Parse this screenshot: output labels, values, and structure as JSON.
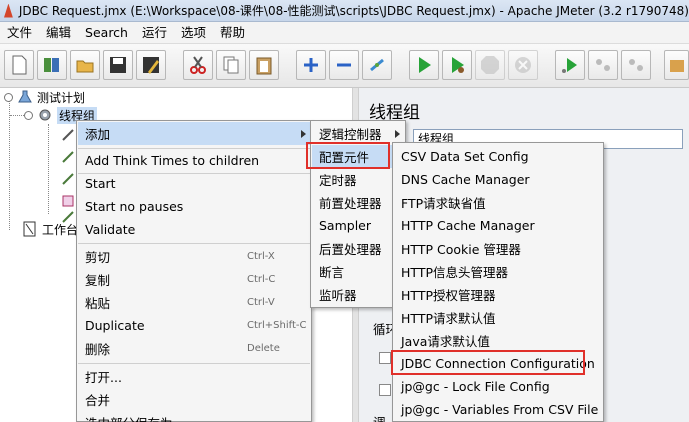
{
  "window": {
    "title": "JDBC Request.jmx (E:\\Workspace\\08-课件\\08-性能测试\\scripts\\JDBC Request.jmx) - Apache JMeter (3.2 r1790748)"
  },
  "menubar": [
    "文件",
    "编辑",
    "Search",
    "运行",
    "选项",
    "帮助"
  ],
  "toolbar": [
    {
      "icon": "new-file-icon"
    },
    {
      "icon": "templates-icon"
    },
    {
      "icon": "open-icon"
    },
    {
      "icon": "save-icon"
    },
    {
      "icon": "save-as-icon"
    },
    {
      "icon": "cut-icon"
    },
    {
      "icon": "copy-icon"
    },
    {
      "icon": "paste-icon"
    },
    {
      "icon": "expand-icon"
    },
    {
      "icon": "collapse-icon"
    },
    {
      "icon": "toggle-icon"
    },
    {
      "icon": "start-icon"
    },
    {
      "icon": "start-no-pauses-icon"
    },
    {
      "icon": "stop-icon"
    },
    {
      "icon": "shutdown-icon"
    },
    {
      "icon": "remote-start-icon"
    },
    {
      "icon": "remote-stop-icon"
    },
    {
      "icon": "remote-shutdown-icon"
    },
    {
      "icon": "clear-icon"
    }
  ],
  "tree": {
    "test_plan": "测试计划",
    "thread_group": "线程组",
    "workbench": "工作台"
  },
  "right_panel": {
    "title": "线程组",
    "name_value": "线程组",
    "partial_label_loop": "循环",
    "partial_label_bottom": "调"
  },
  "context_menu": {
    "add": "添加",
    "add_think_times": "Add Think Times to children",
    "start": "Start",
    "start_no_pauses": "Start no pauses",
    "validate": "Validate",
    "cut": "剪切",
    "cut_sc": "Ctrl-X",
    "copy": "复制",
    "copy_sc": "Ctrl-C",
    "paste": "粘贴",
    "paste_sc": "Ctrl-V",
    "duplicate": "Duplicate",
    "duplicate_sc": "Ctrl+Shift-C",
    "delete": "删除",
    "delete_sc": "Delete",
    "open": "打开...",
    "merge": "合并",
    "save_selection": "选中部分保存为..."
  },
  "submenu_add": [
    "逻辑控制器",
    "配置元件",
    "定时器",
    "前置处理器",
    "Sampler",
    "后置处理器",
    "断言",
    "监听器"
  ],
  "submenu_config": [
    "CSV Data Set Config",
    "DNS Cache Manager",
    "FTP请求缺省值",
    "HTTP Cache Manager",
    "HTTP Cookie 管理器",
    "HTTP信息头管理器",
    "HTTP授权管理器",
    "HTTP请求默认值",
    "Java请求默认值",
    "JDBC Connection Configuration",
    "jp@gc - Lock File Config",
    "jp@gc - Variables From CSV File"
  ],
  "colors": {
    "highlight": "#c6dcf5",
    "annotation_red": "#e0302a"
  }
}
